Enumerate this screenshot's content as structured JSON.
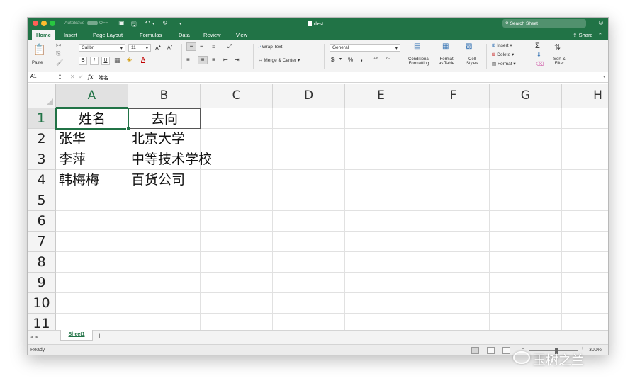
{
  "titlebar": {
    "autosave_label": "AutoSave",
    "autosave_state": "OFF",
    "doc_title": "dest",
    "search_placeholder": "Search Sheet",
    "accent_color": "#217346"
  },
  "tabs": [
    {
      "label": "Home",
      "active": true
    },
    {
      "label": "Insert"
    },
    {
      "label": "Page Layout"
    },
    {
      "label": "Formulas"
    },
    {
      "label": "Data"
    },
    {
      "label": "Review"
    },
    {
      "label": "View"
    }
  ],
  "share_label": "Share",
  "ribbon": {
    "paste_label": "Paste",
    "font_name": "Calibri",
    "font_size": "11",
    "bold": "B",
    "italic": "I",
    "underline": "U",
    "wrap_text": "Wrap Text",
    "merge_center": "Merge & Center",
    "number_format": "General",
    "currency": "$",
    "percent": "%",
    "comma": ",",
    "conditional_formatting": [
      "Conditional",
      "Formatting"
    ],
    "format_as_table": [
      "Format",
      "as Table"
    ],
    "cell_styles": [
      "Cell",
      "Styles"
    ],
    "insert": "Insert",
    "delete": "Delete",
    "format": "Format",
    "sort_filter": [
      "Sort &",
      "Filter"
    ]
  },
  "formula_bar": {
    "name_box": "A1",
    "fx": "fx",
    "content": "姓名"
  },
  "grid": {
    "columns": [
      "A",
      "B",
      "C",
      "D",
      "E",
      "F",
      "G",
      "H"
    ],
    "rows": [
      "1",
      "2",
      "3",
      "4",
      "5",
      "6",
      "7",
      "8",
      "9",
      "10",
      "11"
    ],
    "cells": {
      "A1": "姓名",
      "B1": "去向",
      "A2": "张华",
      "B2": "北京大学",
      "A3": "李萍",
      "B3": "中等技术学校",
      "A4": "韩梅梅",
      "B4": "百货公司"
    },
    "selected": "A1"
  },
  "sheet_tab": "Sheet1",
  "add_sheet": "+",
  "status": "Ready",
  "zoom": "300%",
  "watermark": "玉树之兰"
}
